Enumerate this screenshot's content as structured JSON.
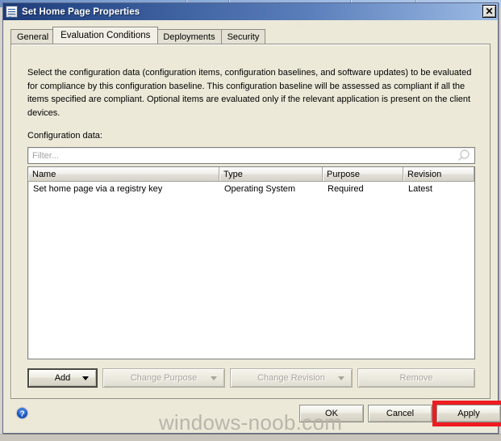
{
  "window": {
    "title": "Set Home Page Properties",
    "icon": "document-properties-icon",
    "close_label": "✕"
  },
  "tabs": [
    {
      "label": "General",
      "active": false
    },
    {
      "label": "Evaluation Conditions",
      "active": true
    },
    {
      "label": "Deployments",
      "active": false
    },
    {
      "label": "Security",
      "active": false
    }
  ],
  "page": {
    "description": "Select the configuration data (configuration items, configuration baselines, and software updates) to be evaluated for compliance by this configuration baseline. This configuration baseline will be assessed as compliant if all the items specified are compliant. Optional items are evaluated only if the relevant application is present on  the client devices.",
    "config_data_label": "Configuration data:"
  },
  "filter": {
    "value": "",
    "placeholder": "Filter...",
    "icon": "search-icon"
  },
  "list": {
    "columns": [
      "Name",
      "Type",
      "Purpose",
      "Revision"
    ],
    "rows": [
      {
        "name": "Set home page via a registry key",
        "type": "Operating System",
        "purpose": "Required",
        "revision": "Latest"
      }
    ]
  },
  "actions": [
    {
      "label": "Add",
      "enabled": true,
      "split": true
    },
    {
      "label": "Change Purpose",
      "enabled": false,
      "split": true
    },
    {
      "label": "Change Revision",
      "enabled": false,
      "split": true
    },
    {
      "label": "Remove",
      "enabled": false,
      "split": false
    }
  ],
  "footer": {
    "help_icon": "help-question-icon",
    "ok_label": "OK",
    "cancel_label": "Cancel",
    "apply_label": "Apply",
    "watermark": "windows-noob.com"
  },
  "colors": {
    "title_gradient_start": "#1f3c78",
    "title_gradient_end": "#9dbbe4",
    "dialog_face": "#ece9d8",
    "highlight_red": "#ee1b20",
    "help_blue": "#1b55b8",
    "watermark_gray": "#b9b5ab"
  }
}
